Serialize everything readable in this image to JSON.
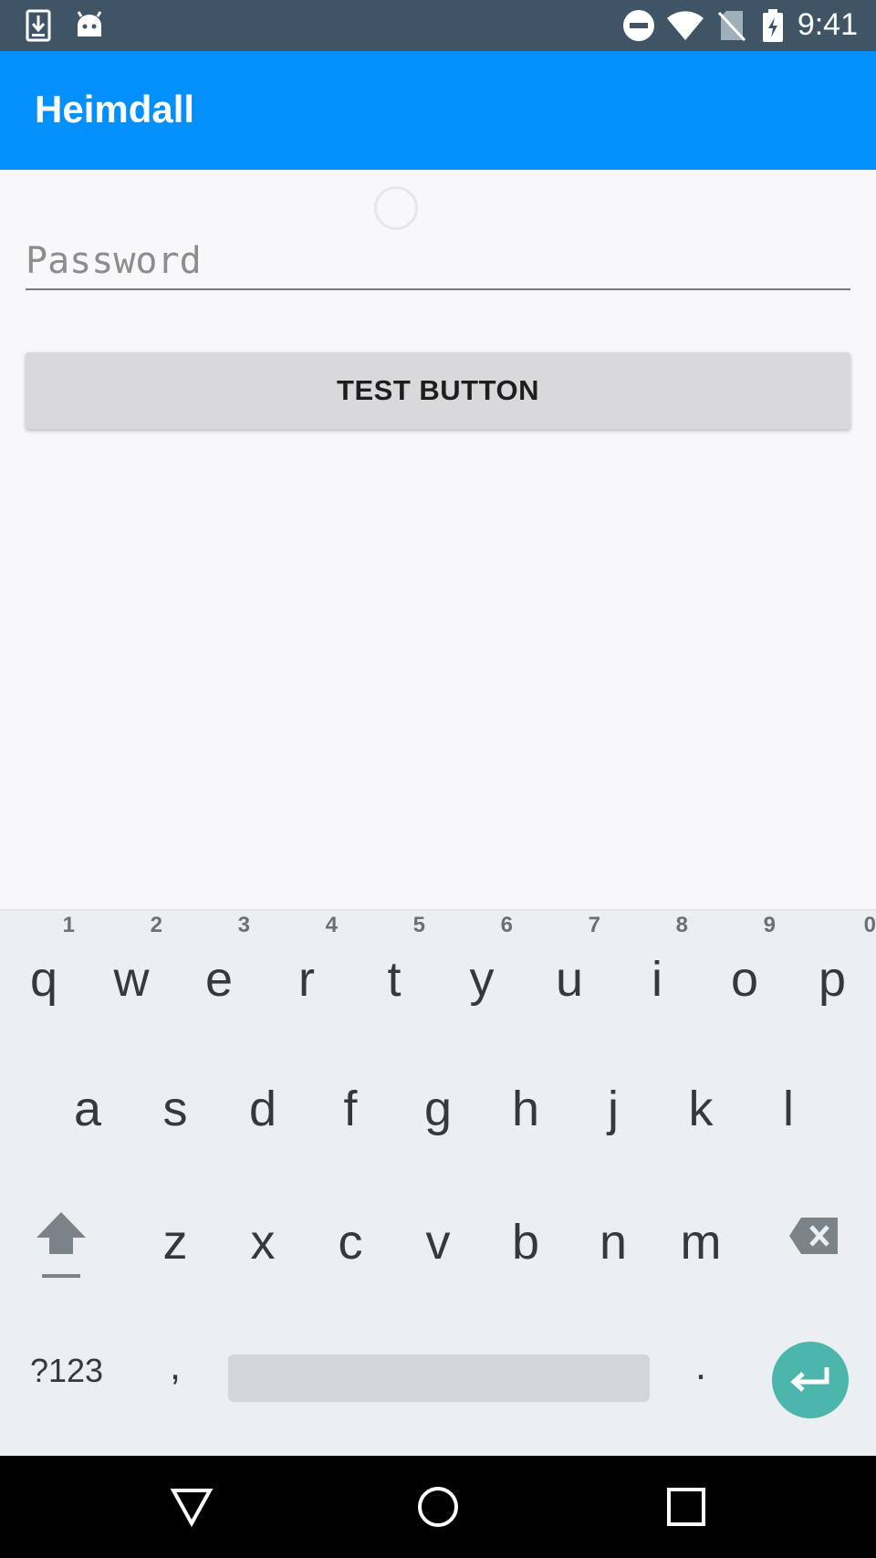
{
  "status_bar": {
    "time": "9:41",
    "icons": [
      "download-icon",
      "android-icon",
      "do-not-disturb-icon",
      "wifi-icon",
      "no-sim-icon",
      "battery-charging-icon"
    ]
  },
  "app_bar": {
    "title": "Heimdall"
  },
  "form": {
    "password_placeholder": "Password",
    "password_value": "",
    "test_button_label": "TEST BUTTON"
  },
  "keyboard": {
    "row1": [
      {
        "key": "q",
        "hint": "1"
      },
      {
        "key": "w",
        "hint": "2"
      },
      {
        "key": "e",
        "hint": "3"
      },
      {
        "key": "r",
        "hint": "4"
      },
      {
        "key": "t",
        "hint": "5"
      },
      {
        "key": "y",
        "hint": "6"
      },
      {
        "key": "u",
        "hint": "7"
      },
      {
        "key": "i",
        "hint": "8"
      },
      {
        "key": "o",
        "hint": "9"
      },
      {
        "key": "p",
        "hint": "0"
      }
    ],
    "row2": [
      "a",
      "s",
      "d",
      "f",
      "g",
      "h",
      "j",
      "k",
      "l"
    ],
    "row3": [
      "z",
      "x",
      "c",
      "v",
      "b",
      "n",
      "m"
    ],
    "symbols_label": "?123",
    "comma": ",",
    "period": ".",
    "accent_color": "#4db6ac"
  },
  "navigation_bar": {
    "icons": [
      "back-icon",
      "home-icon",
      "recents-icon"
    ]
  },
  "colors": {
    "app_bar": "#0390fc",
    "status_bar": "#3f5566"
  }
}
